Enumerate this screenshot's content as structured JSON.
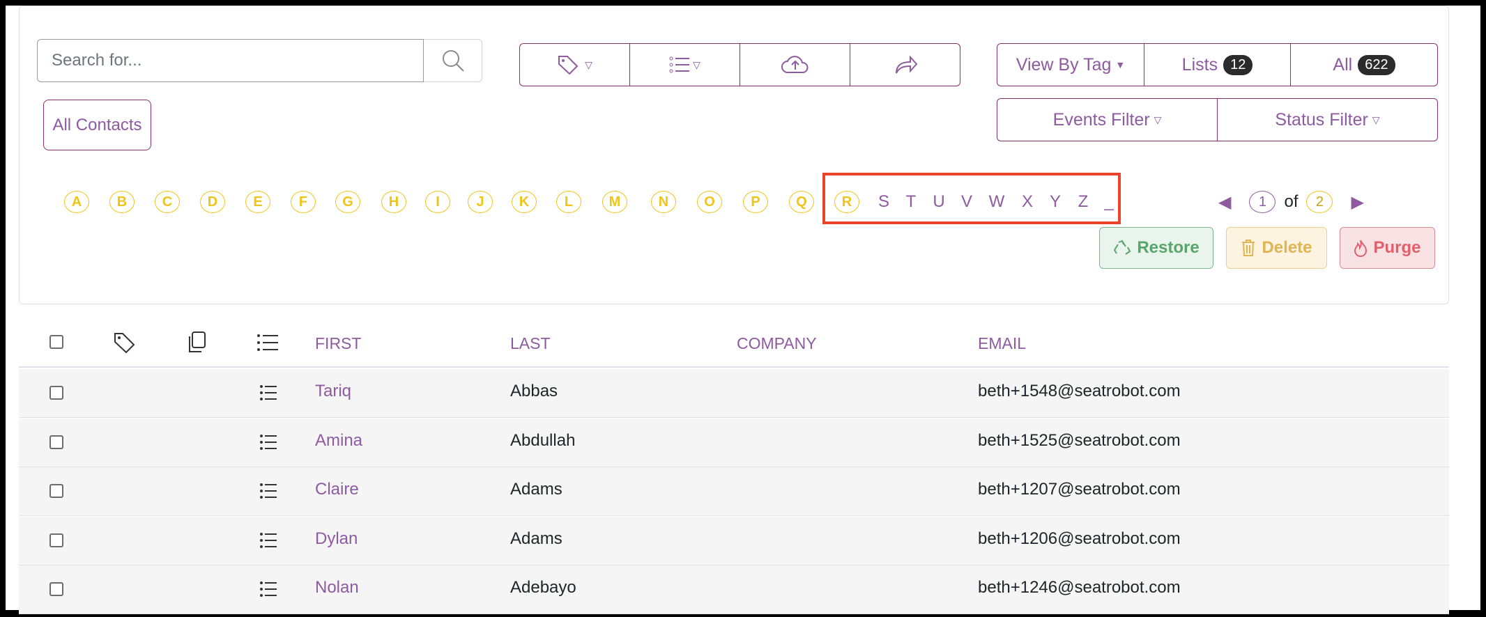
{
  "search": {
    "placeholder": "Search for..."
  },
  "toolbar": {
    "view_by_tag": "View By Tag",
    "lists_label": "Lists",
    "lists_count": "12",
    "all_label": "All",
    "all_count": "622",
    "events_filter": "Events Filter",
    "status_filter": "Status Filter",
    "all_contacts": "All Contacts"
  },
  "alphabet": {
    "circled": [
      "A",
      "B",
      "C",
      "D",
      "E",
      "F",
      "G",
      "H",
      "I",
      "J",
      "K",
      "L",
      "M",
      "N",
      "O",
      "P",
      "Q",
      "R"
    ],
    "plain": [
      "S",
      "T",
      "U",
      "V",
      "W",
      "X",
      "Y",
      "Z",
      "_"
    ]
  },
  "pagination": {
    "current": "1",
    "of": "of",
    "total": "2"
  },
  "actions": {
    "restore": "Restore",
    "delete": "Delete",
    "purge": "Purge"
  },
  "table": {
    "columns": [
      "FIRST",
      "LAST",
      "COMPANY",
      "EMAIL"
    ],
    "rows": [
      {
        "first": "Tariq",
        "last": "Abbas",
        "company": "",
        "email": "beth+1548@seatrobot.com"
      },
      {
        "first": "Amina",
        "last": "Abdullah",
        "company": "",
        "email": "beth+1525@seatrobot.com"
      },
      {
        "first": "Claire",
        "last": "Adams",
        "company": "",
        "email": "beth+1207@seatrobot.com"
      },
      {
        "first": "Dylan",
        "last": "Adams",
        "company": "",
        "email": "beth+1206@seatrobot.com"
      },
      {
        "first": "Nolan",
        "last": "Adebayo",
        "company": "",
        "email": "beth+1246@seatrobot.com"
      }
    ]
  },
  "colors": {
    "accent": "#8e5aa0",
    "letter": "#f0c419",
    "highlight": "#e8452c"
  }
}
